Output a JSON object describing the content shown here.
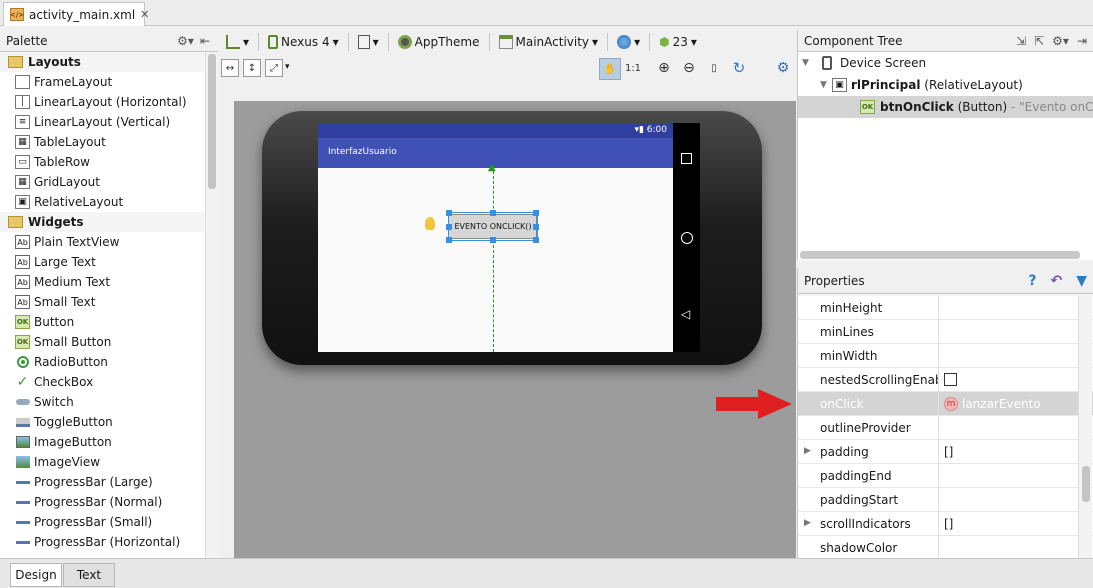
{
  "file_tab": {
    "label": "activity_main.xml",
    "icon": "xml-file-icon"
  },
  "palette": {
    "title": "Palette",
    "groups": [
      {
        "label": "Layouts",
        "items": [
          "FrameLayout",
          "LinearLayout (Horizontal)",
          "LinearLayout (Vertical)",
          "TableLayout",
          "TableRow",
          "GridLayout",
          "RelativeLayout"
        ]
      },
      {
        "label": "Widgets",
        "items": [
          "Plain TextView",
          "Large Text",
          "Medium Text",
          "Small Text",
          "Button",
          "Small Button",
          "RadioButton",
          "CheckBox",
          "Switch",
          "ToggleButton",
          "ImageButton",
          "ImageView",
          "ProgressBar (Large)",
          "ProgressBar (Normal)",
          "ProgressBar (Small)",
          "ProgressBar (Horizontal)"
        ]
      }
    ]
  },
  "toolbar": {
    "device": "Nexus 4",
    "theme": "AppTheme",
    "activity": "MainActivity",
    "api": "23"
  },
  "device_preview": {
    "time": "6:00",
    "app_title": "InterfazUsuario",
    "button_text": "EVENTO ONCLICK()"
  },
  "component_tree": {
    "title": "Component Tree",
    "root": "Device Screen",
    "layout_id": "rlPrincipal",
    "layout_type": "(RelativeLayout)",
    "button_id": "btnOnClick",
    "button_type": "(Button)",
    "button_desc": "- \"Evento onClick()\""
  },
  "properties": {
    "title": "Properties",
    "rows": [
      {
        "name": "minHeight",
        "value": ""
      },
      {
        "name": "minLines",
        "value": ""
      },
      {
        "name": "minWidth",
        "value": ""
      },
      {
        "name": "nestedScrollingEnabled",
        "value": ""
      },
      {
        "name": "onClick",
        "value": "lanzarEvento"
      },
      {
        "name": "outlineProvider",
        "value": ""
      },
      {
        "name": "padding",
        "value": "[]"
      },
      {
        "name": "paddingEnd",
        "value": ""
      },
      {
        "name": "paddingStart",
        "value": ""
      },
      {
        "name": "scrollIndicators",
        "value": "[]"
      },
      {
        "name": "shadowColor",
        "value": ""
      }
    ]
  },
  "bottom_tabs": {
    "design": "Design",
    "text": "Text"
  },
  "colors": {
    "accent_blue": "#3f51b5",
    "selection_blue": "#3a8fe0",
    "arrow_red": "#e02020",
    "guide_green": "#1a9b1a"
  }
}
